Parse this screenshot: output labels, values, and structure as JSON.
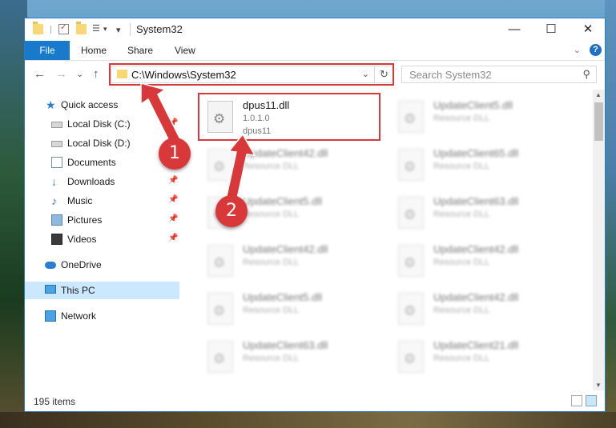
{
  "window": {
    "title": "System32",
    "minimize_glyph": "—",
    "maximize_glyph": "☐",
    "close_glyph": "✕"
  },
  "quick_access_toolbar": {
    "icons": [
      "folder-icon",
      "properties-icon",
      "new-folder-icon",
      "customize-icon"
    ]
  },
  "ribbon": {
    "tabs": [
      "File",
      "Home",
      "Share",
      "View"
    ],
    "expand_glyph": "⌄",
    "help_glyph": "?"
  },
  "navigation": {
    "back_glyph": "←",
    "forward_glyph": "→",
    "recent_glyph": "⌄",
    "up_glyph": "↑",
    "address_path": "C:\\Windows\\System32",
    "address_dropdown_glyph": "⌄",
    "refresh_glyph": "↻",
    "search_placeholder": "Search System32",
    "search_glyph": "⚲"
  },
  "sidebar": {
    "items": [
      {
        "label": "Quick access",
        "icon": "star-icon",
        "pinned": false
      },
      {
        "label": "Local Disk (C:)",
        "icon": "drive-icon",
        "pinned": true
      },
      {
        "label": "Local Disk (D:)",
        "icon": "drive-icon",
        "pinned": false
      },
      {
        "label": "Documents",
        "icon": "document-icon",
        "pinned": true
      },
      {
        "label": "Downloads",
        "icon": "download-icon",
        "pinned": true
      },
      {
        "label": "Music",
        "icon": "music-icon",
        "pinned": true
      },
      {
        "label": "Pictures",
        "icon": "pictures-icon",
        "pinned": true
      },
      {
        "label": "Videos",
        "icon": "videos-icon",
        "pinned": true
      },
      {
        "label": "OneDrive",
        "icon": "cloud-icon",
        "pinned": false
      },
      {
        "label": "This PC",
        "icon": "computer-icon",
        "pinned": false,
        "selected": true
      },
      {
        "label": "Network",
        "icon": "network-icon",
        "pinned": false
      }
    ],
    "pin_glyph": "📌"
  },
  "files": [
    {
      "name": "dpus11.dll",
      "line1": "1.0.1.0",
      "line2": "dpus11",
      "highlighted": true
    },
    {
      "name": "UpdateClient5.dll",
      "line1": "Resource DLL",
      "line2": ""
    },
    {
      "name": "UpdateClient42.dll",
      "line1": "Resource DLL",
      "line2": ""
    },
    {
      "name": "UpdateClient65.dll",
      "line1": "Resource DLL",
      "line2": ""
    },
    {
      "name": "UpdateClient5.dll",
      "line1": "Resource DLL",
      "line2": ""
    },
    {
      "name": "UpdateClient63.dll",
      "line1": "Resource DLL",
      "line2": ""
    },
    {
      "name": "UpdateClient42.dll",
      "line1": "Resource DLL",
      "line2": ""
    },
    {
      "name": "UpdateClient42.dll",
      "line1": "Resource DLL",
      "line2": ""
    },
    {
      "name": "UpdateClient5.dll",
      "line1": "Resource DLL",
      "line2": ""
    },
    {
      "name": "UpdateClient42.dll",
      "line1": "Resource DLL",
      "line2": ""
    },
    {
      "name": "UpdateClient63.dll",
      "line1": "Resource DLL",
      "line2": ""
    },
    {
      "name": "UpdateClient21.dll",
      "line1": "Resource DLL",
      "line2": ""
    }
  ],
  "status": {
    "item_count": "195 items"
  },
  "annotations": {
    "step1": "1",
    "step2": "2",
    "color": "#d9383b"
  }
}
